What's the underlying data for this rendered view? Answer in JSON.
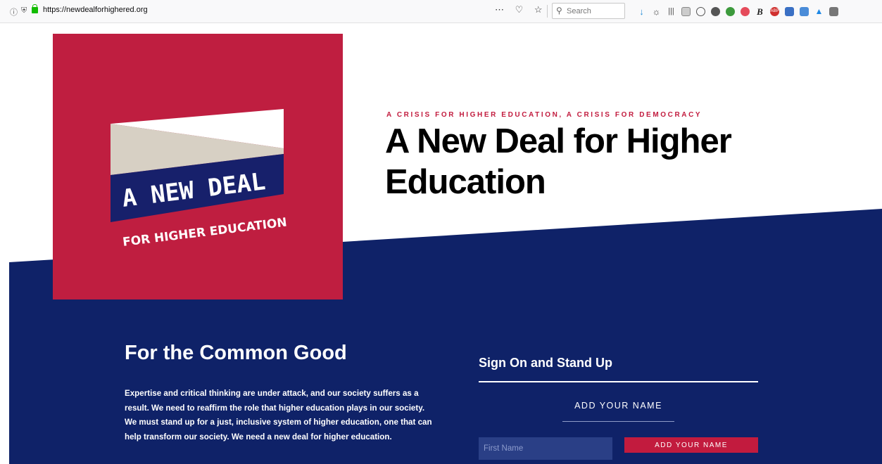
{
  "browser": {
    "url": "https://newdealforhighered.org",
    "page_actions": "⋯ ♡ ☆",
    "search_placeholder": "Search",
    "extension_icons": [
      "download-icon",
      "gear-icon",
      "library-icon",
      "reader-icon",
      "account-icon",
      "extension-icon",
      "extension-icon",
      "shield-icon",
      "bookmark-icon",
      "adblock-icon",
      "save-icon",
      "screenshot-icon",
      "extension-icon",
      "camera-icon"
    ]
  },
  "hero": {
    "logo": {
      "line1": "A NEW DEAL",
      "line2": "FOR HIGHER EDUCATION"
    },
    "eyebrow": "A CRISIS FOR HIGHER EDUCATION, A CRISIS FOR DEMOCRACY",
    "title": "A New Deal for Higher Education"
  },
  "common_good": {
    "title": "For the Common Good",
    "body": "Expertise and critical thinking are under attack, and our society suffers as a result. We need to reaffirm the role that higher education plays in our society. We must stand up for a just, inclusive system of higher education, one that can help transform our society. We need a new deal for higher education."
  },
  "sign_on": {
    "title": "Sign On and Stand Up",
    "form_heading": "ADD YOUR NAME",
    "first_name_placeholder": "First Name",
    "submit_label": "ADD YOUR NAME"
  },
  "colors": {
    "navy": "#0f2268",
    "crimson": "#bf1e40",
    "beige": "#d7d0c4"
  }
}
